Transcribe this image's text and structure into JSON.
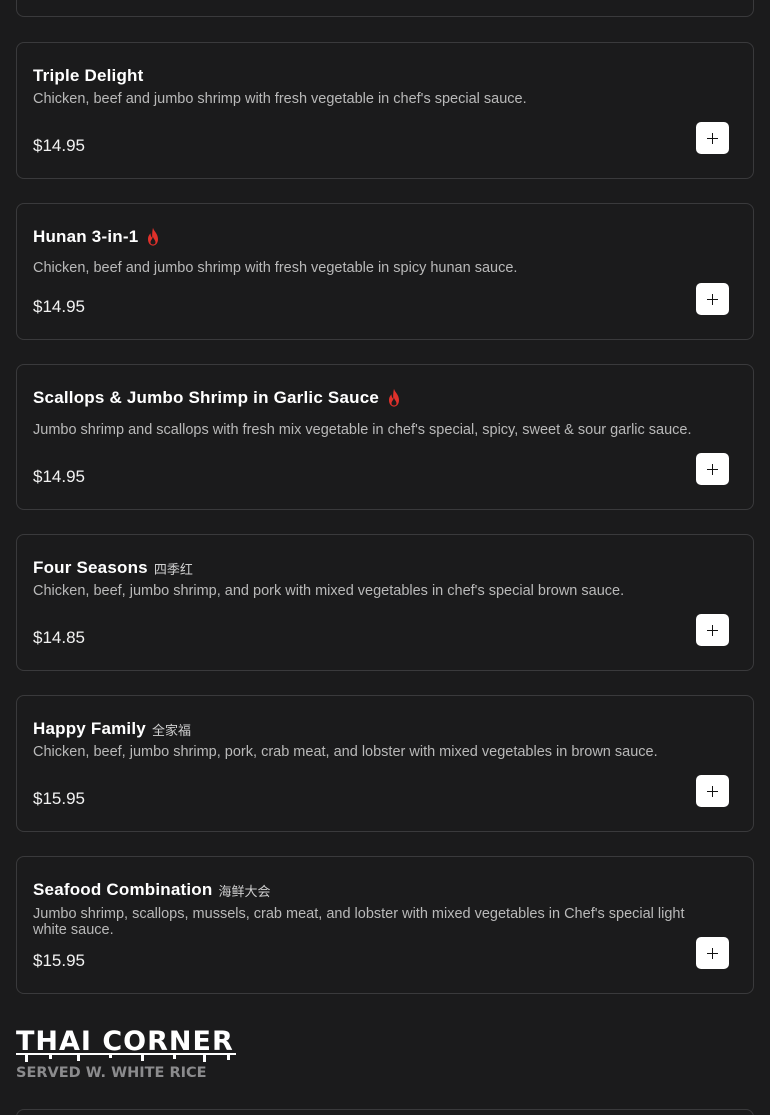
{
  "items": [
    {
      "title": "Triple Delight",
      "zh": "",
      "spicy": false,
      "description": "Chicken, beef and jumbo shrimp with fresh vegetable in chef's special sauce.",
      "price": "$14.95"
    },
    {
      "title": "Hunan 3-in-1",
      "zh": "",
      "spicy": true,
      "description": "Chicken, beef and jumbo shrimp with fresh vegetable in spicy hunan sauce.",
      "price": "$14.95"
    },
    {
      "title": "Scallops & Jumbo Shrimp in Garlic Sauce",
      "zh": "",
      "spicy": true,
      "description": "Jumbo shrimp and scallops with fresh mix vegetable in chef's special, spicy, sweet & sour garlic sauce.",
      "price": "$14.95"
    },
    {
      "title": "Four Seasons",
      "zh": "四季红",
      "spicy": false,
      "description": "Chicken, beef, jumbo shrimp, and pork with mixed vegetables in chef's special brown sauce.",
      "price": "$14.85"
    },
    {
      "title": "Happy Family",
      "zh": "全家福",
      "spicy": false,
      "description": "Chicken, beef, jumbo shrimp, pork, crab meat, and lobster with mixed vegetables in brown sauce.",
      "price": "$15.95"
    },
    {
      "title": "Seafood Combination",
      "zh": "海鲜大会",
      "spicy": false,
      "description": "Jumbo shrimp, scallops, mussels, crab meat, and lobster with mixed vegetables in Chef's special light white sauce.",
      "price": "$15.95"
    }
  ],
  "section": {
    "title": "THAI CORNER",
    "subtitle": "SERVED W. WHITE RICE"
  },
  "icons": {
    "add": "plus-icon",
    "spicy": "fire-icon"
  },
  "colors": {
    "background": "#1b1b1c",
    "card_border": "#3a3a3c",
    "spicy": "#e0312b",
    "add_button": "#ffffff"
  }
}
